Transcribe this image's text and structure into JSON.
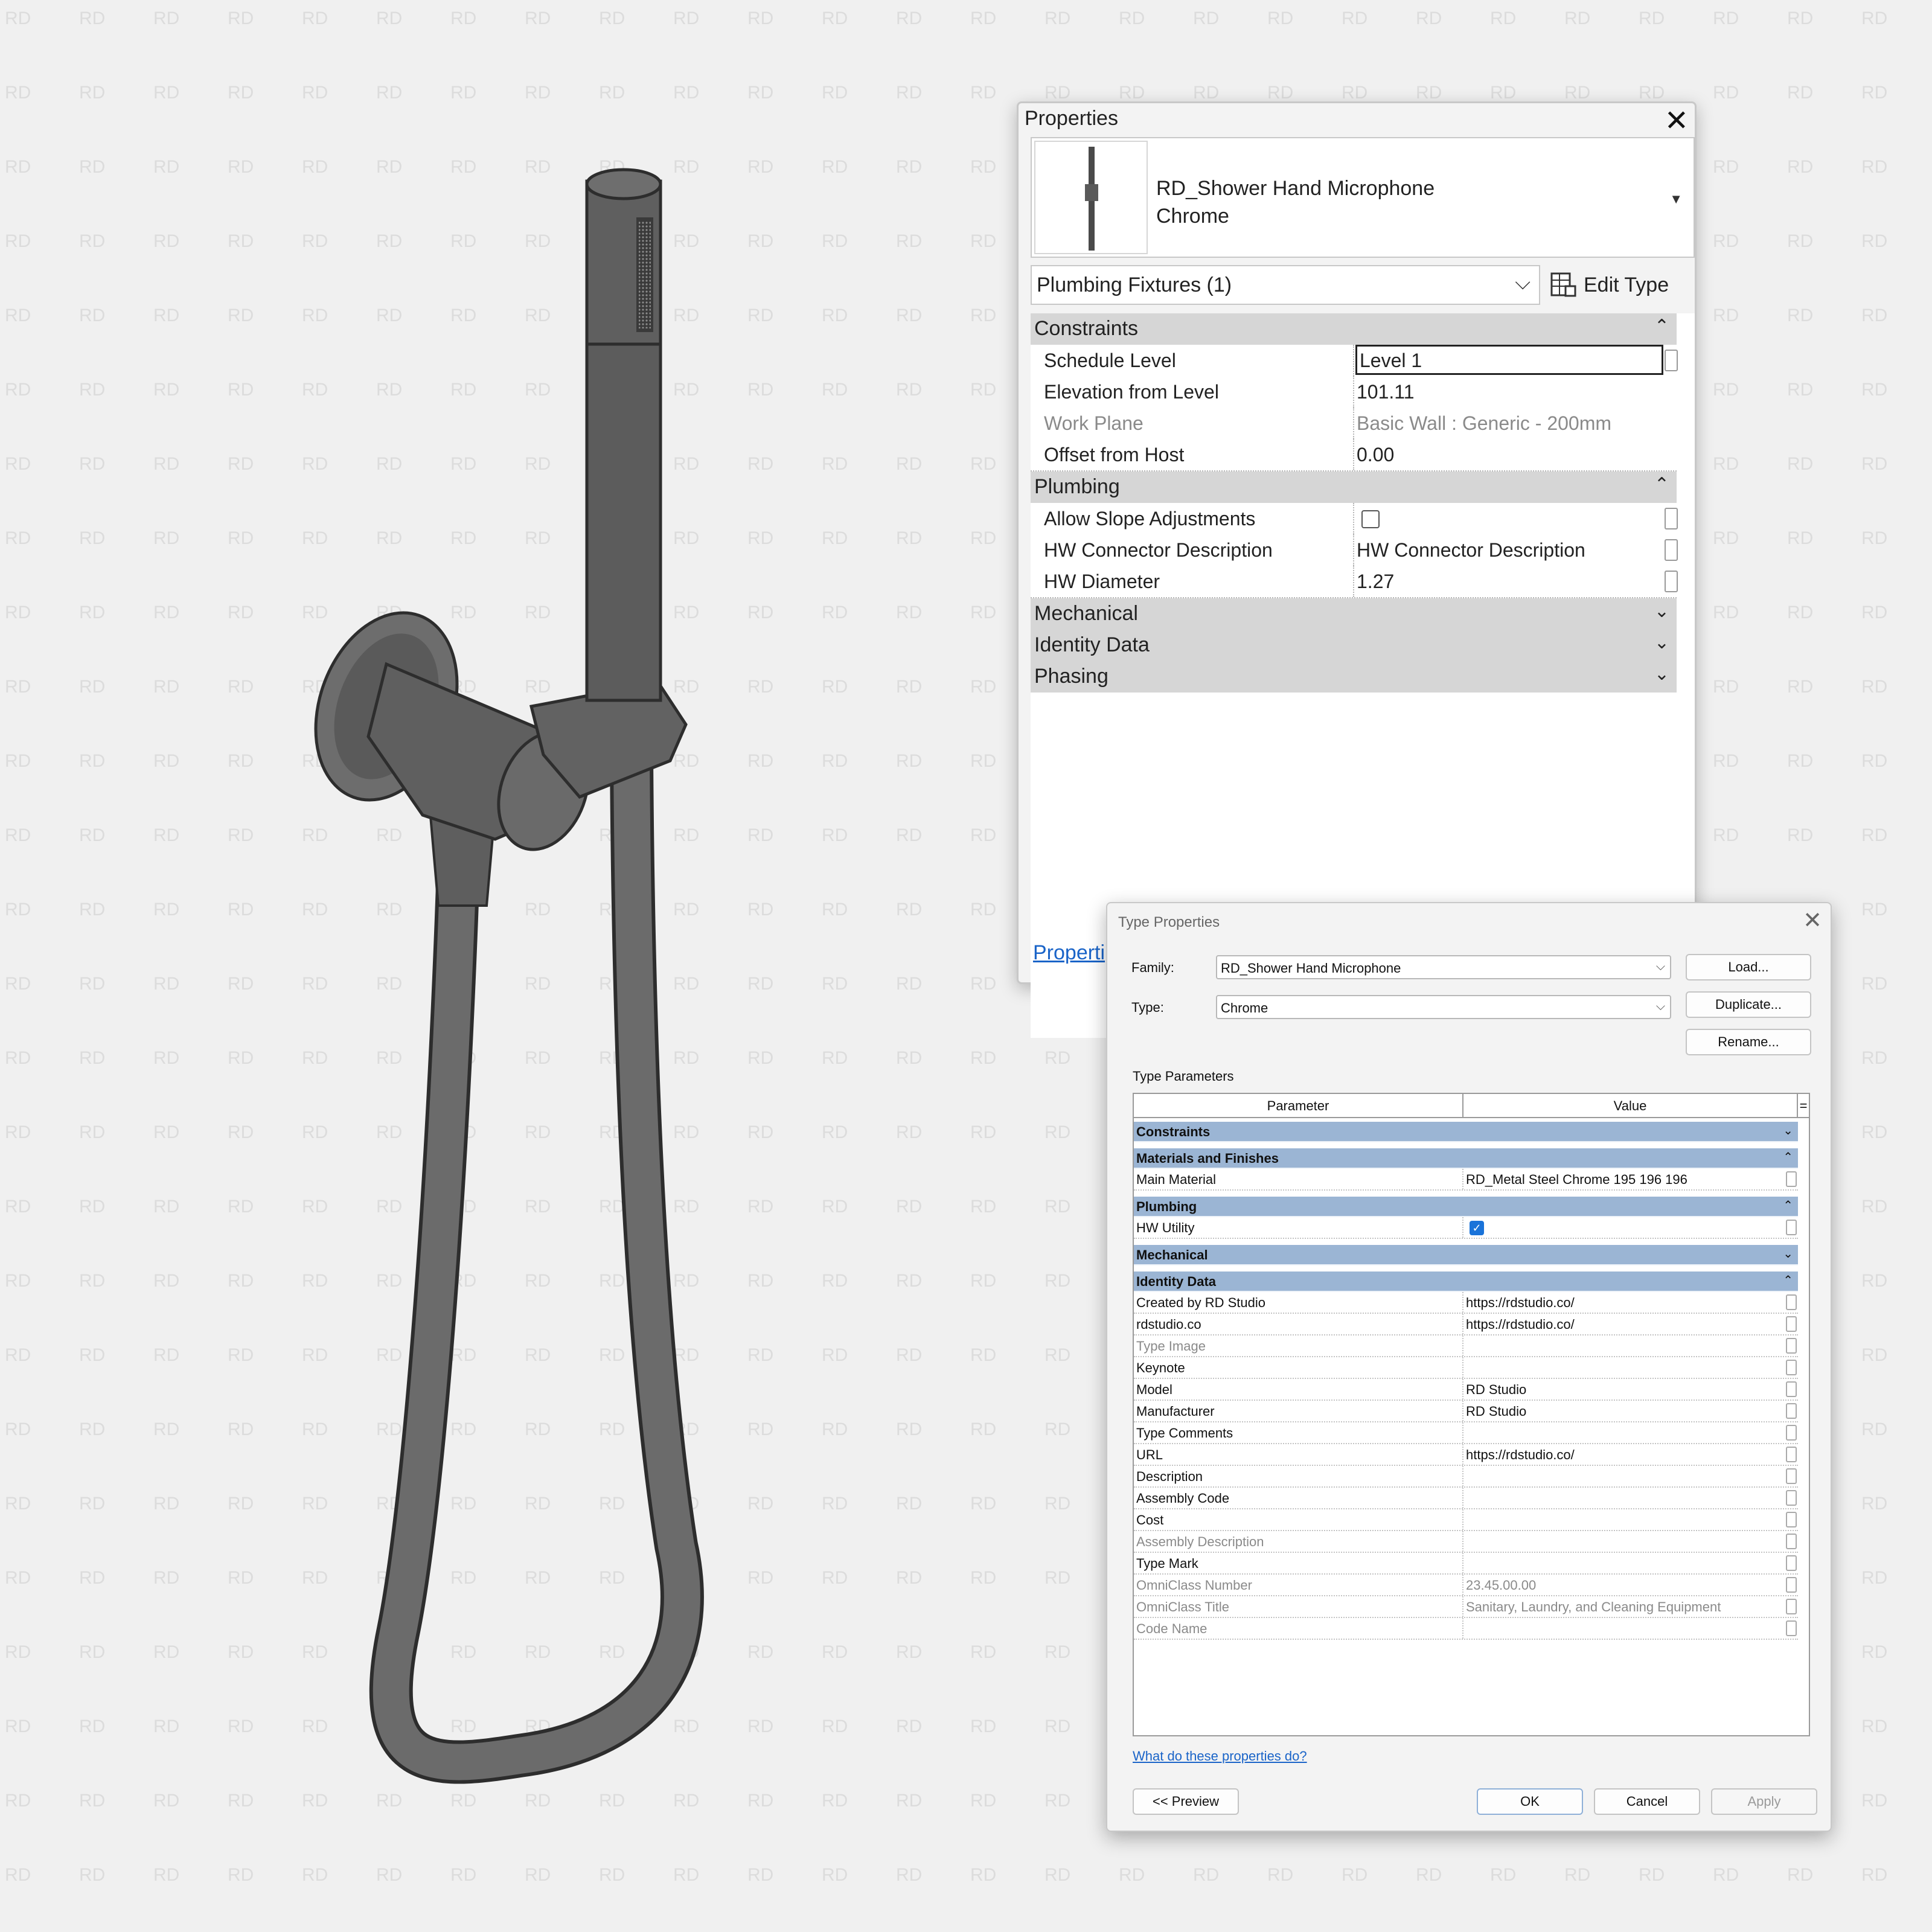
{
  "watermark": {
    "text": "RD"
  },
  "properties_palette": {
    "title": "Properties",
    "family_name": "RD_Shower Hand Microphone",
    "type_name": "Chrome",
    "category_selector": "Plumbing Fixtures (1)",
    "edit_type_label": "Edit Type",
    "sections": [
      {
        "label": "Constraints",
        "collapsed": false,
        "rows": [
          {
            "name": "Schedule Level",
            "value": "Level 1"
          },
          {
            "name": "Elevation from Level",
            "value": "101.11"
          },
          {
            "name": "Work Plane",
            "value": "Basic Wall : Generic - 200mm",
            "disabled": true
          },
          {
            "name": "Offset from Host",
            "value": "0.00"
          }
        ]
      },
      {
        "label": "Plumbing",
        "collapsed": false,
        "rows": [
          {
            "name": "Allow Slope Adjustments",
            "checkbox": true,
            "checked": false
          },
          {
            "name": "HW Connector Description",
            "value": "HW Connector Description"
          },
          {
            "name": "HW Diameter",
            "value": "1.27"
          }
        ]
      },
      {
        "label": "Mechanical",
        "collapsed": true
      },
      {
        "label": "Identity Data",
        "collapsed": true
      },
      {
        "label": "Phasing",
        "collapsed": true
      }
    ],
    "help_link": "Properti"
  },
  "type_properties": {
    "title": "Type Properties",
    "family_label": "Family:",
    "family_value": "RD_Shower Hand Microphone",
    "type_label": "Type:",
    "type_value": "Chrome",
    "buttons": {
      "load": "Load...",
      "duplicate": "Duplicate...",
      "rename": "Rename..."
    },
    "params_label": "Type Parameters",
    "columns": {
      "parameter": "Parameter",
      "value": "Value",
      "extra": "="
    },
    "sections": [
      {
        "label": "Constraints",
        "collapsed": true,
        "rows": []
      },
      {
        "label": "Materials and Finishes",
        "collapsed": false,
        "rows": [
          {
            "name": "Main Material",
            "value": "RD_Metal Steel Chrome 195 196 196"
          }
        ]
      },
      {
        "label": "Plumbing",
        "collapsed": false,
        "rows": [
          {
            "name": "HW Utility",
            "checked": true
          }
        ]
      },
      {
        "label": "Mechanical",
        "collapsed": true,
        "rows": []
      },
      {
        "label": "Identity Data",
        "collapsed": false,
        "rows": [
          {
            "name": "Created by RD Studio",
            "value": "https://rdstudio.co/"
          },
          {
            "name": "rdstudio.co",
            "value": "https://rdstudio.co/"
          },
          {
            "name": "Type Image",
            "value": "",
            "disabled": true
          },
          {
            "name": "Keynote",
            "value": ""
          },
          {
            "name": "Model",
            "value": "RD Studio"
          },
          {
            "name": "Manufacturer",
            "value": "RD Studio"
          },
          {
            "name": "Type Comments",
            "value": ""
          },
          {
            "name": "URL",
            "value": "https://rdstudio.co/"
          },
          {
            "name": "Description",
            "value": ""
          },
          {
            "name": "Assembly Code",
            "value": ""
          },
          {
            "name": "Cost",
            "value": ""
          },
          {
            "name": "Assembly Description",
            "value": "",
            "disabled": true
          },
          {
            "name": "Type Mark",
            "value": ""
          },
          {
            "name": "OmniClass Number",
            "value": "23.45.00.00",
            "disabled": true
          },
          {
            "name": "OmniClass Title",
            "value": "Sanitary, Laundry, and Cleaning Equipment",
            "disabled": true
          },
          {
            "name": "Code Name",
            "value": "",
            "disabled": true
          }
        ]
      }
    ],
    "help_link": "What do these properties do?",
    "footer": {
      "preview": "<< Preview",
      "ok": "OK",
      "cancel": "Cancel",
      "apply": "Apply"
    }
  }
}
